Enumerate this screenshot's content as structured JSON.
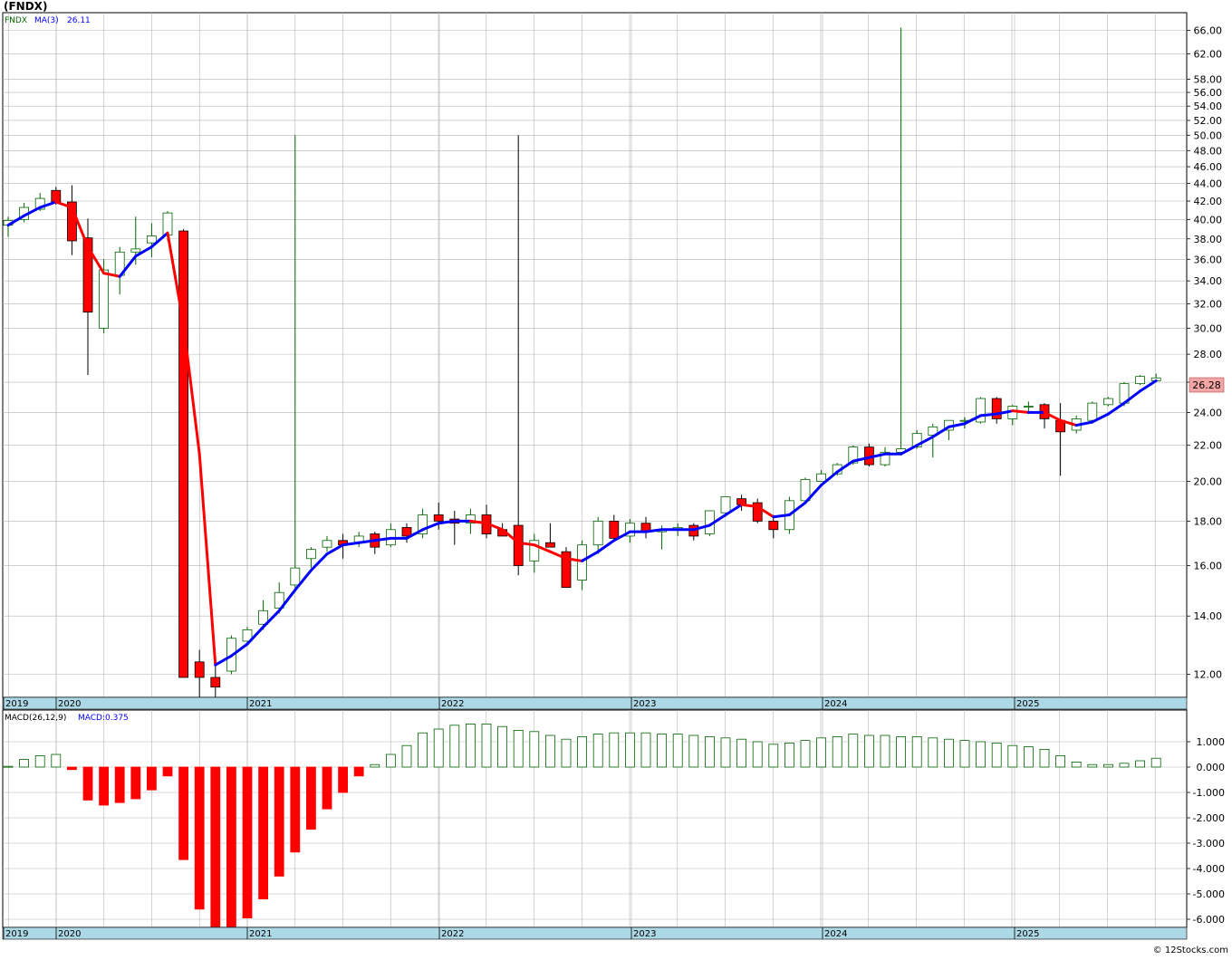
{
  "header": {
    "title": "(FNDX)",
    "ticker": "FNDX",
    "ma_label": "MA(3)",
    "ma_value": "26.11",
    "macd_label": "MACD(26,12,9)",
    "macd_value": "MACD:0.375",
    "credit": "© 12Stocks.com"
  },
  "colors": {
    "up": "#006400",
    "down": "#ff0000",
    "ma_up": "#0000ff",
    "ma_down": "#ff0000",
    "grid": "#b4b4b4",
    "axis_band": "#add8e6",
    "price_tag": "#f4a6a6"
  },
  "chart_data": [
    {
      "type": "candlestick",
      "scale": "log",
      "ylim": [
        11.2,
        68
      ],
      "y_ticks": [
        "12.00",
        "14.00",
        "16.00",
        "18.00",
        "20.00",
        "22.00",
        "24.00",
        "26.00",
        "28.00",
        "30.00",
        "32.00",
        "34.00",
        "36.00",
        "38.00",
        "40.00",
        "42.00",
        "44.00",
        "46.00",
        "48.00",
        "50.00",
        "52.00",
        "54.00",
        "56.00",
        "58.00",
        "62.00",
        "66.00"
      ],
      "x_ticks": [
        "2019",
        "2020",
        "2021",
        "2022",
        "2023",
        "2024",
        "2025"
      ],
      "last_price": "26.28",
      "ohlc": [
        [
          39.4,
          40.3,
          38.2,
          39.9
        ],
        [
          40.0,
          41.8,
          39.7,
          41.3
        ],
        [
          41.1,
          42.9,
          40.9,
          42.3
        ],
        [
          43.2,
          43.6,
          41.6,
          41.9
        ],
        [
          41.9,
          43.8,
          36.4,
          37.8
        ],
        [
          38.1,
          40.1,
          26.5,
          31.3
        ],
        [
          30.0,
          36.0,
          29.6,
          35.0
        ],
        [
          34.5,
          37.2,
          32.8,
          36.7
        ],
        [
          36.7,
          40.3,
          35.5,
          37.0
        ],
        [
          37.6,
          39.6,
          36.2,
          38.3
        ],
        [
          38.4,
          40.9,
          37.8,
          40.7
        ],
        [
          38.8,
          39.0,
          11.9,
          11.9
        ],
        [
          12.4,
          12.8,
          11.2,
          11.9
        ],
        [
          11.9,
          12.6,
          11.2,
          11.6
        ],
        [
          12.1,
          13.3,
          12.0,
          13.2
        ],
        [
          13.1,
          13.6,
          13.0,
          13.5
        ],
        [
          13.7,
          14.6,
          13.5,
          14.2
        ],
        [
          14.3,
          15.3,
          14.1,
          14.9
        ],
        [
          15.2,
          50.0,
          14.9,
          15.9
        ],
        [
          16.3,
          16.8,
          15.9,
          16.7
        ],
        [
          16.8,
          17.3,
          16.6,
          17.1
        ],
        [
          17.1,
          17.4,
          16.3,
          16.9
        ],
        [
          17.0,
          17.5,
          16.8,
          17.3
        ],
        [
          17.4,
          17.5,
          16.5,
          16.8
        ],
        [
          16.9,
          17.9,
          16.8,
          17.6
        ],
        [
          17.7,
          17.9,
          17.0,
          17.3
        ],
        [
          17.4,
          18.6,
          17.2,
          18.3
        ],
        [
          18.3,
          18.9,
          17.6,
          18.0
        ],
        [
          18.1,
          18.5,
          16.9,
          17.9
        ],
        [
          17.9,
          18.6,
          17.4,
          18.3
        ],
        [
          18.3,
          18.8,
          17.2,
          17.4
        ],
        [
          17.6,
          17.9,
          17.3,
          17.3
        ],
        [
          17.8,
          50.0,
          15.6,
          16.0
        ],
        [
          16.2,
          17.4,
          15.7,
          17.1
        ],
        [
          17.0,
          17.9,
          16.8,
          16.8
        ],
        [
          16.6,
          16.8,
          15.2,
          15.1
        ],
        [
          15.4,
          17.1,
          15.0,
          16.9
        ],
        [
          16.9,
          18.2,
          16.5,
          18.0
        ],
        [
          18.0,
          18.3,
          17.1,
          17.2
        ],
        [
          17.3,
          18.1,
          17.0,
          17.9
        ],
        [
          17.9,
          18.2,
          17.2,
          17.5
        ],
        [
          17.5,
          17.8,
          16.7,
          17.6
        ],
        [
          17.6,
          17.9,
          17.3,
          17.7
        ],
        [
          17.8,
          17.9,
          17.1,
          17.3
        ],
        [
          17.4,
          18.5,
          17.3,
          18.5
        ],
        [
          18.4,
          19.2,
          18.2,
          19.2
        ],
        [
          19.1,
          19.3,
          18.5,
          18.8
        ],
        [
          18.9,
          19.1,
          17.9,
          18.0
        ],
        [
          18.0,
          18.3,
          17.2,
          17.6
        ],
        [
          17.6,
          19.2,
          17.4,
          19.0
        ],
        [
          19.0,
          20.2,
          18.9,
          20.1
        ],
        [
          20.0,
          20.6,
          20.0,
          20.4
        ],
        [
          20.4,
          21.0,
          20.3,
          20.9
        ],
        [
          21.0,
          22.0,
          20.9,
          21.9
        ],
        [
          21.9,
          22.1,
          20.8,
          20.9
        ],
        [
          20.9,
          21.9,
          20.8,
          21.6
        ],
        [
          21.6,
          66.5,
          21.5,
          21.8
        ],
        [
          21.9,
          22.9,
          21.8,
          22.7
        ],
        [
          22.6,
          23.3,
          21.3,
          23.1
        ],
        [
          22.9,
          23.5,
          22.3,
          23.5
        ],
        [
          23.5,
          23.7,
          23.0,
          23.5
        ],
        [
          23.4,
          25.0,
          23.3,
          24.9
        ],
        [
          24.9,
          25.0,
          23.3,
          23.6
        ],
        [
          23.6,
          24.5,
          23.2,
          24.4
        ],
        [
          24.4,
          24.7,
          23.9,
          24.4
        ],
        [
          24.5,
          24.6,
          23.0,
          23.6
        ],
        [
          23.5,
          24.6,
          20.3,
          22.8
        ],
        [
          22.9,
          23.8,
          22.7,
          23.6
        ],
        [
          23.5,
          24.7,
          23.3,
          24.6
        ],
        [
          24.5,
          25.0,
          24.4,
          24.9
        ],
        [
          24.6,
          26.0,
          24.4,
          25.9
        ],
        [
          25.9,
          26.5,
          25.8,
          26.4
        ],
        [
          26.1,
          26.6,
          26.0,
          26.3
        ]
      ],
      "ma": [
        39.4,
        40.4,
        41.3,
        41.9,
        41.3,
        37.2,
        34.7,
        34.4,
        36.3,
        37.2,
        38.6,
        30.3,
        21.5,
        12.3,
        12.6,
        13.0,
        13.6,
        14.2,
        15.0,
        15.8,
        16.5,
        16.9,
        17.0,
        17.1,
        17.2,
        17.2,
        17.6,
        17.9,
        18.0,
        18.0,
        17.9,
        17.6,
        17.0,
        16.9,
        16.6,
        16.3,
        16.2,
        16.6,
        17.1,
        17.5,
        17.5,
        17.6,
        17.6,
        17.6,
        17.8,
        18.3,
        18.8,
        18.7,
        18.2,
        18.3,
        18.9,
        19.8,
        20.5,
        21.1,
        21.3,
        21.5,
        21.5,
        22.0,
        22.5,
        23.1,
        23.3,
        23.8,
        23.9,
        24.1,
        24.0,
        24.0,
        23.5,
        23.2,
        23.4,
        23.9,
        24.6,
        25.4,
        26.1
      ]
    },
    {
      "type": "bar",
      "name": "MACD(26,12,9)",
      "ylim": [
        -6.4,
        1.75
      ],
      "y_ticks": [
        "1.000",
        "0.000",
        "-1.000",
        "-2.000",
        "-3.000",
        "-4.000",
        "-5.000",
        "-6.000"
      ],
      "x_ticks": [
        "2019",
        "2020",
        "2021",
        "2022",
        "2023",
        "2024",
        "2025"
      ],
      "values": [
        0.03,
        0.3,
        0.45,
        0.5,
        -0.1,
        -1.3,
        -1.5,
        -1.4,
        -1.25,
        -0.9,
        -0.35,
        -3.65,
        -5.6,
        -6.3,
        -6.35,
        -5.95,
        -5.2,
        -4.3,
        -3.35,
        -2.45,
        -1.65,
        -1.0,
        -0.35,
        0.1,
        0.5,
        0.85,
        1.35,
        1.5,
        1.65,
        1.7,
        1.7,
        1.6,
        1.45,
        1.4,
        1.25,
        1.1,
        1.2,
        1.3,
        1.35,
        1.35,
        1.35,
        1.3,
        1.3,
        1.25,
        1.2,
        1.15,
        1.1,
        1.0,
        0.9,
        0.95,
        1.05,
        1.15,
        1.2,
        1.3,
        1.25,
        1.25,
        1.2,
        1.2,
        1.15,
        1.1,
        1.05,
        1.0,
        0.95,
        0.85,
        0.8,
        0.7,
        0.45,
        0.2,
        0.1,
        0.1,
        0.15,
        0.25,
        0.35
      ]
    }
  ]
}
